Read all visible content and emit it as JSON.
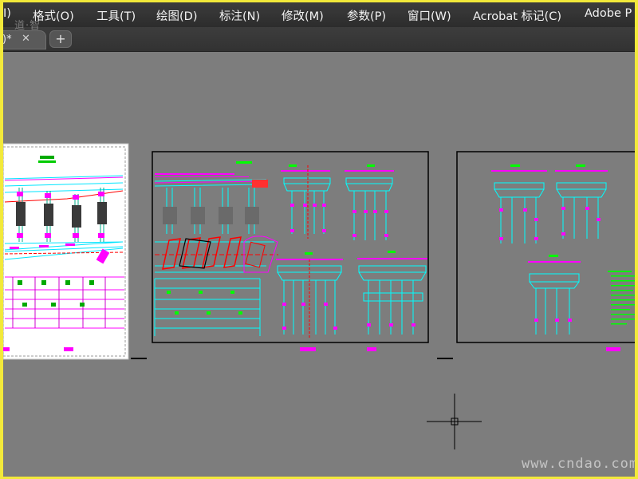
{
  "menubar": {
    "items": [
      {
        "label": "I)"
      },
      {
        "label": "格式(O)"
      },
      {
        "label": "工具(T)"
      },
      {
        "label": "绘图(D)"
      },
      {
        "label": "标注(N)"
      },
      {
        "label": "修改(M)"
      },
      {
        "label": "参数(P)"
      },
      {
        "label": "窗口(W)"
      },
      {
        "label": "Acrobat 标记(C)"
      },
      {
        "label": "Adobe P"
      }
    ]
  },
  "tabs": {
    "active_title": ")*",
    "close_glyph": "✕",
    "add_glyph": "+"
  },
  "watermark_top": "道·智",
  "watermark": "www.cndao.com",
  "colors": {
    "canvas": "#7d7d7d",
    "cyan": "#00ffff",
    "magenta": "#ff00ff",
    "green": "#00ff00",
    "red": "#ff0000",
    "white": "#ffffff"
  }
}
